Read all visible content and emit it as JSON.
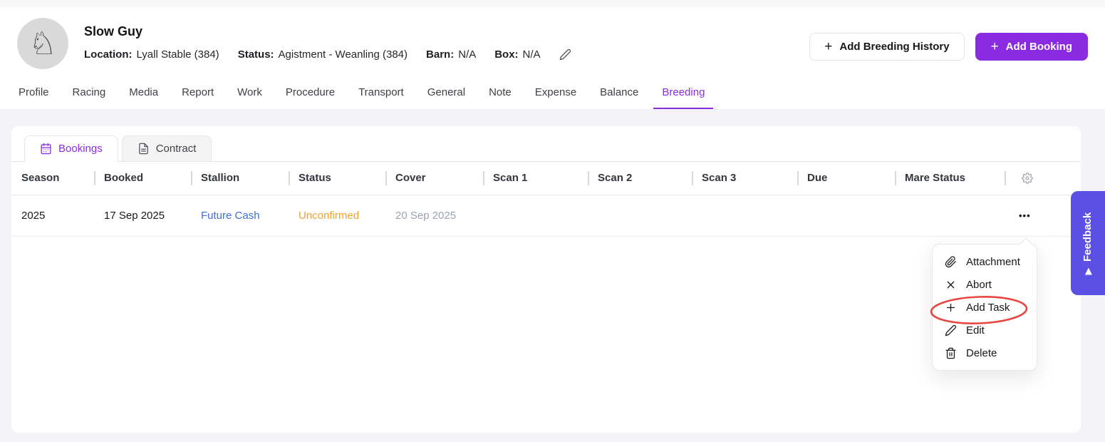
{
  "icons": {
    "plus": "+",
    "more": "•••",
    "horse": "♘",
    "feedback_arrow": "▶"
  },
  "colors": {
    "accent_purple": "#8A2BE2",
    "feedback_purple": "#5B50E4",
    "status_orange": "#F0A030",
    "link_blue": "#3D6EE0",
    "annotation_red": "#E8473F"
  },
  "header": {
    "horse_name": "Slow Guy",
    "meta": [
      {
        "label": "Location:",
        "value": "Lyall Stable (384)"
      },
      {
        "label": "Status:",
        "value": "Agistment - Weanling (384)"
      },
      {
        "label": "Barn:",
        "value": "N/A"
      },
      {
        "label": "Box:",
        "value": "N/A"
      }
    ],
    "add_breeding_history_label": "Add Breeding History",
    "add_booking_label": "Add Booking"
  },
  "nav": {
    "items": [
      "Profile",
      "Racing",
      "Media",
      "Report",
      "Work",
      "Procedure",
      "Transport",
      "General",
      "Note",
      "Expense",
      "Balance",
      "Breeding"
    ],
    "active": "Breeding"
  },
  "panel": {
    "sub_tabs": [
      {
        "label": "Bookings",
        "icon": "calendar-icon",
        "active": true
      },
      {
        "label": "Contract",
        "icon": "file-text-icon",
        "active": false
      }
    ],
    "table": {
      "columns": [
        "Season",
        "Booked",
        "Stallion",
        "Status",
        "Cover",
        "Scan 1",
        "Scan 2",
        "Scan 3",
        "Due",
        "Mare Status"
      ],
      "rows": [
        {
          "season": "2025",
          "booked": "17 Sep 2025",
          "stallion": "Future Cash",
          "status": "Unconfirmed",
          "cover": "20 Sep 2025",
          "scan_1": "",
          "scan_2": "",
          "scan_3": "",
          "due": "",
          "mare_status": ""
        }
      ]
    }
  },
  "context_menu": {
    "items": [
      {
        "icon": "paperclip-icon",
        "label": "Attachment"
      },
      {
        "icon": "close-icon",
        "label": "Abort"
      },
      {
        "icon": "plus-icon",
        "label": "Add Task"
      },
      {
        "icon": "pencil-icon",
        "label": "Edit"
      },
      {
        "icon": "trash-icon",
        "label": "Delete"
      }
    ],
    "highlighted_item": "Add Task"
  },
  "feedback": {
    "label": "Feedback"
  }
}
